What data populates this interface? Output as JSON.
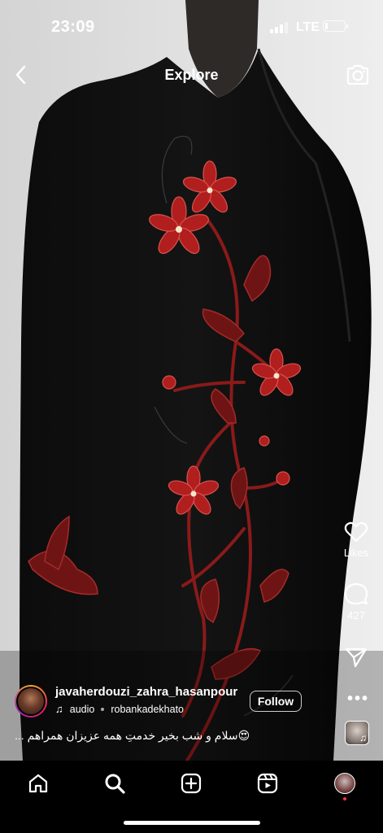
{
  "status_bar": {
    "time": "23:09",
    "network": "LTE",
    "battery_level": 0.12
  },
  "header": {
    "title": "Explore",
    "back_icon": "chevron-left-icon",
    "camera_icon": "camera-icon"
  },
  "actions": {
    "like_icon": "heart-icon",
    "like_label": "Likes",
    "comment_icon": "comment-icon",
    "comment_count": "427",
    "share_icon": "send-icon",
    "more_icon": "more-icon"
  },
  "post": {
    "username": "javaherdouzi_zahra_hasanpour",
    "audio_label": "audio",
    "audio_source": "robankadekhato",
    "follow_label": "Follow",
    "caption": "... سلام و شب بخیر خدمتِ همه عزیزان همراهم😍"
  },
  "bottom_nav": {
    "items": [
      "home-icon",
      "search-icon",
      "create-icon",
      "reels-icon",
      "profile-avatar"
    ]
  },
  "colors": {
    "background": "#000000",
    "accent_red": "#ff3040",
    "embroidery": "#8b1a1a"
  }
}
